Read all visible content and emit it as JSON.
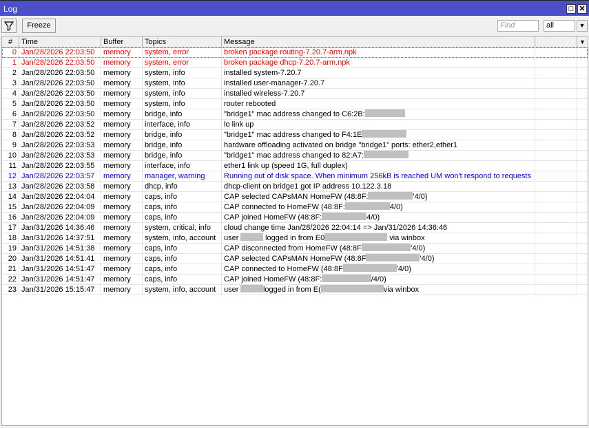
{
  "window": {
    "title": "Log"
  },
  "toolbar": {
    "freeze_label": "Freeze",
    "find_placeholder": "Find",
    "filter_value": "all"
  },
  "columns": [
    "#",
    "Time",
    "Buffer",
    "Topics",
    "Message"
  ],
  "colors": {
    "error": "#ff0000",
    "warning": "#0000ff",
    "titlebar": "#4b50c8"
  },
  "rows": [
    {
      "n": "0",
      "time": "Jan/28/2026 22:03:50",
      "buffer": "memory",
      "topics": "system, error",
      "level": "error",
      "msg": [
        {
          "t": "broken package routing-7.20.7-arm.npk"
        }
      ]
    },
    {
      "n": "1",
      "time": "Jan/28/2026 22:03:50",
      "buffer": "memory",
      "topics": "system, error",
      "level": "error",
      "msg": [
        {
          "t": "broken package dhcp-7.20.7-arm.npk"
        }
      ]
    },
    {
      "n": "2",
      "time": "Jan/28/2026 22:03:50",
      "buffer": "memory",
      "topics": "system, info",
      "msg": [
        {
          "t": "installed system-7.20.7"
        }
      ]
    },
    {
      "n": "3",
      "time": "Jan/28/2026 22:03:50",
      "buffer": "memory",
      "topics": "system, info",
      "msg": [
        {
          "t": "installed user-manager-7.20.7"
        }
      ]
    },
    {
      "n": "4",
      "time": "Jan/28/2026 22:03:50",
      "buffer": "memory",
      "topics": "system, info",
      "msg": [
        {
          "t": "installed wireless-7.20.7"
        }
      ]
    },
    {
      "n": "5",
      "time": "Jan/28/2026 22:03:50",
      "buffer": "memory",
      "topics": "system, info",
      "msg": [
        {
          "t": "router rebooted"
        }
      ]
    },
    {
      "n": "6",
      "time": "Jan/28/2026 22:03:50",
      "buffer": "memory",
      "topics": "bridge, info",
      "msg": [
        {
          "t": "\"bridge1\" mac address changed to C6:2B:"
        },
        {
          "r": 9
        }
      ]
    },
    {
      "n": "7",
      "time": "Jan/28/2026 22:03:52",
      "buffer": "memory",
      "topics": "interface, info",
      "msg": [
        {
          "t": "lo link up"
        }
      ]
    },
    {
      "n": "8",
      "time": "Jan/28/2026 22:03:52",
      "buffer": "memory",
      "topics": "bridge, info",
      "msg": [
        {
          "t": "\"bridge1\" mac address changed to F4:1E"
        },
        {
          "r": 10
        }
      ]
    },
    {
      "n": "9",
      "time": "Jan/28/2026 22:03:53",
      "buffer": "memory",
      "topics": "bridge, info",
      "msg": [
        {
          "t": "hardware offloading activated on bridge \"bridge1\" ports: ether2,ether1"
        }
      ]
    },
    {
      "n": "10",
      "time": "Jan/28/2026 22:03:53",
      "buffer": "memory",
      "topics": "bridge, info",
      "msg": [
        {
          "t": "\"bridge1\" mac address changed to 82:A7:"
        },
        {
          "r": 10
        }
      ]
    },
    {
      "n": "11",
      "time": "Jan/28/2026 22:03:55",
      "buffer": "memory",
      "topics": "interface, info",
      "msg": [
        {
          "t": "ether1 link up (speed 1G, full duplex)"
        }
      ]
    },
    {
      "n": "12",
      "time": "Jan/28/2026 22:03:57",
      "buffer": "memory",
      "topics": "manager, warning",
      "level": "warning",
      "msg": [
        {
          "t": "Running out of disk space. When minimum 256kB is reached UM won't respond to requests"
        }
      ]
    },
    {
      "n": "13",
      "time": "Jan/28/2026 22:03:58",
      "buffer": "memory",
      "topics": "dhcp, info",
      "msg": [
        {
          "t": "dhcp-client on bridge1 got IP address 10.122.3.18"
        }
      ]
    },
    {
      "n": "14",
      "time": "Jan/28/2026 22:04:04",
      "buffer": "memory",
      "topics": "caps, info",
      "msg": [
        {
          "t": "CAP selected CAPsMAN HomeFW (48:8F:"
        },
        {
          "r": 10
        },
        {
          "t": "'4/0)"
        }
      ]
    },
    {
      "n": "15",
      "time": "Jan/28/2026 22:04:09",
      "buffer": "memory",
      "topics": "caps, info",
      "msg": [
        {
          "t": "CAP connected to HomeFW (48:8F:"
        },
        {
          "r": 10
        },
        {
          "t": "4/0)"
        }
      ]
    },
    {
      "n": "16",
      "time": "Jan/28/2026 22:04:09",
      "buffer": "memory",
      "topics": "caps, info",
      "msg": [
        {
          "t": "CAP joined HomeFW (48:8F:"
        },
        {
          "r": 10
        },
        {
          "t": "4/0)"
        }
      ]
    },
    {
      "n": "17",
      "time": "Jan/31/2026 14:36:46",
      "buffer": "memory",
      "topics": "system, critical, info",
      "msg": [
        {
          "t": "cloud change time Jan/28/2026 22:04:14 => Jan/31/2026 14:36:46"
        }
      ]
    },
    {
      "n": "18",
      "time": "Jan/31/2026 14:37:51",
      "buffer": "memory",
      "topics": "system, info, account",
      "msg": [
        {
          "t": "user "
        },
        {
          "r": 5
        },
        {
          "t": " logged in from E0"
        },
        {
          "r": 14
        },
        {
          "t": " via winbox"
        }
      ]
    },
    {
      "n": "19",
      "time": "Jan/31/2026 14:51:38",
      "buffer": "memory",
      "topics": "caps, info",
      "msg": [
        {
          "t": "CAP disconnected from HomeFW (48:8F"
        },
        {
          "r": 11
        },
        {
          "t": "'4/0)"
        }
      ]
    },
    {
      "n": "20",
      "time": "Jan/31/2026 14:51:41",
      "buffer": "memory",
      "topics": "caps, info",
      "msg": [
        {
          "t": "CAP selected CAPsMAN HomeFW (48:8F"
        },
        {
          "r": 12
        },
        {
          "t": "'4/0)"
        }
      ]
    },
    {
      "n": "21",
      "time": "Jan/31/2026 14:51:47",
      "buffer": "memory",
      "topics": "caps, info",
      "msg": [
        {
          "t": "CAP connected to HomeFW (48:8F"
        },
        {
          "r": 12
        },
        {
          "t": "'4/0)"
        }
      ]
    },
    {
      "n": "22",
      "time": "Jan/31/2026 14:51:47",
      "buffer": "memory",
      "topics": "caps, info",
      "msg": [
        {
          "t": "CAP joined HomeFW (48:8F:"
        },
        {
          "r": 11
        },
        {
          "t": "/4/0)"
        }
      ]
    },
    {
      "n": "23",
      "time": "Jan/31/2026 15:15:47",
      "buffer": "memory",
      "topics": "system, info, account",
      "msg": [
        {
          "t": "user "
        },
        {
          "r": 5
        },
        {
          "t": "logged in from E("
        },
        {
          "r": 14
        },
        {
          "t": "via winbox"
        }
      ]
    }
  ]
}
